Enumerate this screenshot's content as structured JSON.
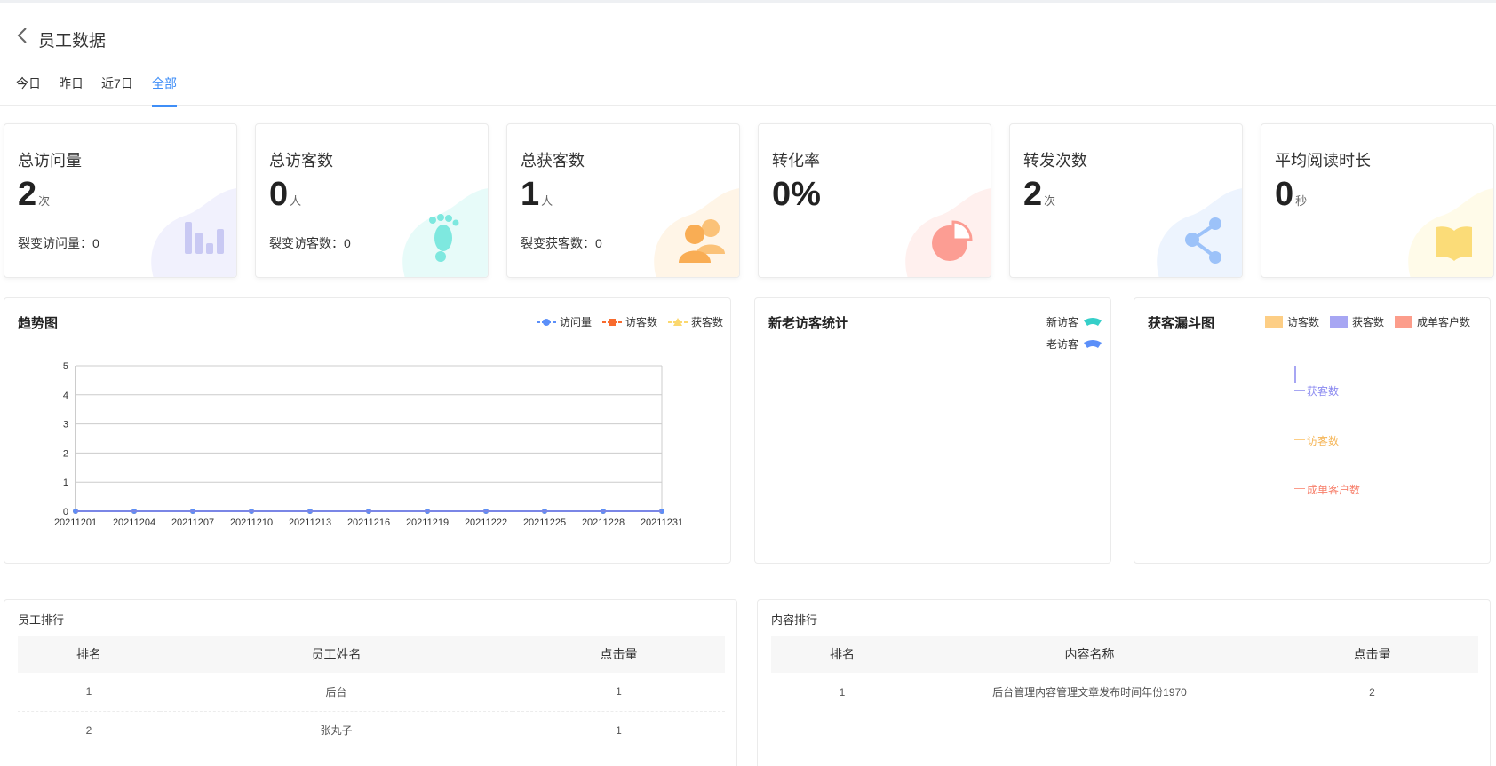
{
  "header": {
    "title": "员工数据"
  },
  "tabs": [
    {
      "label": "今日"
    },
    {
      "label": "昨日"
    },
    {
      "label": "近7日"
    },
    {
      "label": "全部",
      "active": true
    }
  ],
  "cards": [
    {
      "title": "总访问量",
      "value": "2",
      "unit": "次",
      "sub": "裂变访问量：0",
      "icon": "bar-chart-icon",
      "color": "#c9c9f3"
    },
    {
      "title": "总访客数",
      "value": "0",
      "unit": "人",
      "sub": "裂变访客数：0",
      "icon": "footprint-icon",
      "color": "#7ee8df"
    },
    {
      "title": "总获客数",
      "value": "1",
      "unit": "人",
      "sub": "裂变获客数：0",
      "icon": "users-icon",
      "color": "#fbc278"
    },
    {
      "title": "转化率",
      "value": "0%",
      "unit": "",
      "sub": "",
      "icon": "pie-chart-icon",
      "color": "#fc9d93"
    },
    {
      "title": "转发次数",
      "value": "2",
      "unit": "次",
      "sub": "",
      "icon": "share-icon",
      "color": "#9cc2f9"
    },
    {
      "title": "平均阅读时长",
      "value": "0",
      "unit": "秒",
      "sub": "",
      "icon": "book-icon",
      "color": "#fbdc78"
    }
  ],
  "trend": {
    "title": "趋势图",
    "legend": [
      "访问量",
      "访客数",
      "获客数"
    ]
  },
  "visitor": {
    "title": "新老访客统计",
    "legend": [
      "新访客",
      "老访客"
    ]
  },
  "funnel": {
    "title": "获客漏斗图",
    "legend": [
      "访客数",
      "获客数",
      "成单客户数"
    ],
    "labels": [
      "获客数",
      "访客数",
      "成单客户数"
    ]
  },
  "chart_data": [
    {
      "type": "line",
      "x": [
        "20211201",
        "20211204",
        "20211207",
        "20211210",
        "20211213",
        "20211216",
        "20211219",
        "20211222",
        "20211225",
        "20211228",
        "20211231"
      ],
      "series": [
        {
          "name": "访问量",
          "values": [
            0,
            0,
            0,
            0,
            0,
            0,
            0,
            0,
            0,
            0,
            0
          ]
        },
        {
          "name": "访客数",
          "values": [
            0,
            0,
            0,
            0,
            0,
            0,
            0,
            0,
            0,
            0,
            0
          ]
        },
        {
          "name": "获客数",
          "values": [
            0,
            0,
            0,
            0,
            0,
            0,
            0,
            0,
            0,
            0,
            0
          ]
        }
      ],
      "yticks": [
        "0",
        "1",
        "2",
        "3",
        "4",
        "5"
      ],
      "ylim": [
        0,
        5
      ],
      "grid": true,
      "legend": "top-right",
      "colors": [
        "#5b8ff9",
        "#f86b2e",
        "#fbd86f"
      ]
    }
  ],
  "staff_rank": {
    "title": "员工排行",
    "columns": [
      "排名",
      "员工姓名",
      "点击量"
    ],
    "rows": [
      [
        "1",
        "后台",
        "1"
      ],
      [
        "2",
        "张丸子",
        "1"
      ]
    ]
  },
  "content_rank": {
    "title": "内容排行",
    "columns": [
      "排名",
      "内容名称",
      "点击量"
    ],
    "rows": [
      [
        "1",
        "后台管理内容管理文章发布时间年份1970",
        "2"
      ]
    ]
  },
  "colors": {
    "accent": "#3f8ef7"
  }
}
